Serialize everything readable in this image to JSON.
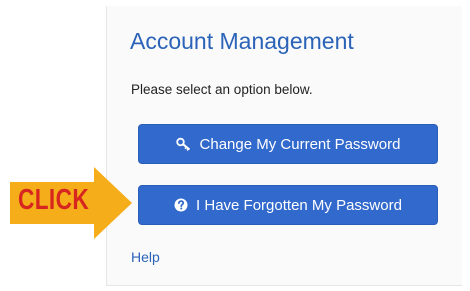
{
  "account": {
    "title": "Account Management",
    "subtitle": "Please select an option below.",
    "change_password_label": "Change My Current Password",
    "forgot_password_label": "I Have Forgotten My Password",
    "help_label": "Help"
  },
  "annotation": {
    "callout_label": "CLICK",
    "arrow_color": "#f5ad1a",
    "text_color": "#d7261f"
  },
  "icons": {
    "change_password": "key-icon",
    "forgot_password": "question-circle-icon"
  },
  "colors": {
    "button_blue": "#3269cc",
    "link_blue": "#2a63b8"
  }
}
